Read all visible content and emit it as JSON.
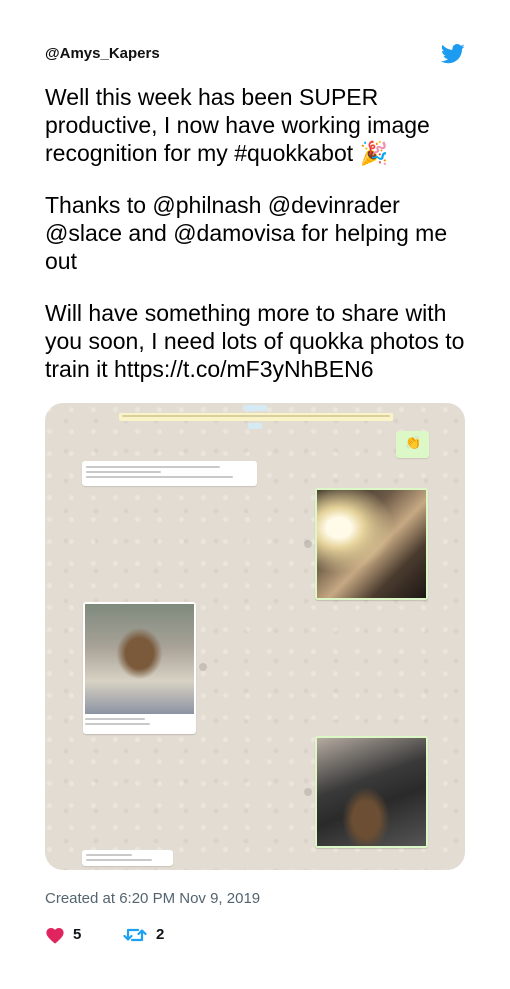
{
  "tweet": {
    "handle": "@Amys_Kapers",
    "paragraphs": [
      "Well this week has been SUPER productive, I now have working image recognition for my #quokkabot 🎉",
      "Thanks to @philnash @devinrader @slace and @damovisa for helping me out",
      "Will have something more to share with you soon, I need lots of quokka photos to train it https://t.co/mF3yNhBEN6"
    ],
    "created_at": "Created at 6:20 PM Nov 9, 2019",
    "likes": "5",
    "retweets": "2"
  },
  "icons": {
    "brand": "twitter-bird-icon",
    "like": "heart-icon",
    "retweet": "retweet-icon"
  },
  "colors": {
    "twitter_blue": "#1d9bf0",
    "heart_pink": "#e0245e",
    "retweet_blue": "#1da1f2",
    "meta_grey": "#536471"
  },
  "media": {
    "emoji_reaction": "👏"
  }
}
